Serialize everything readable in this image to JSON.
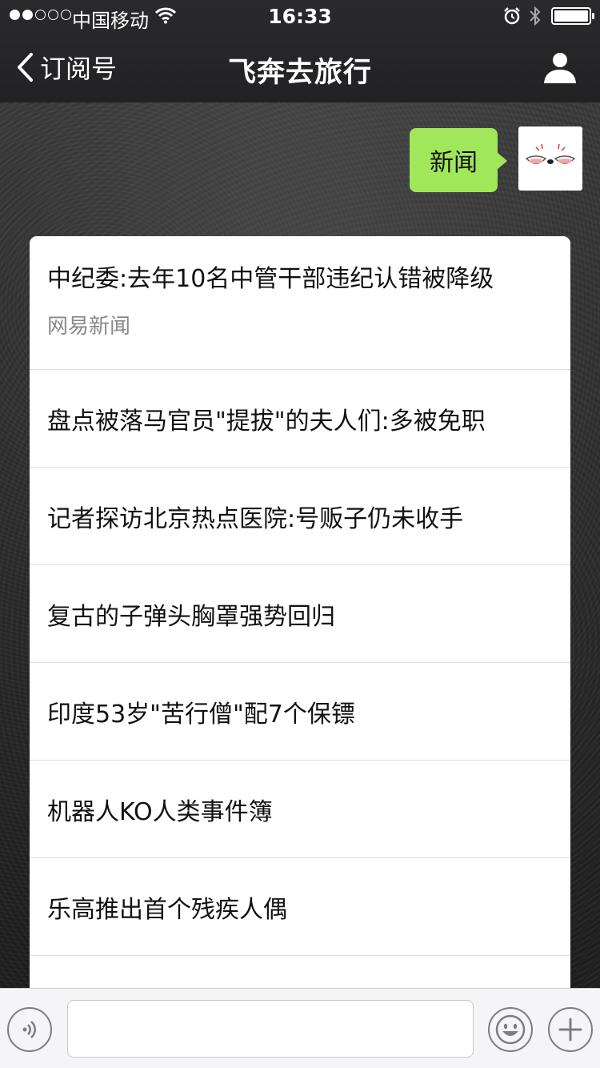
{
  "status_bar": {
    "carrier": "中国移动",
    "time": "16:33",
    "signal_bars_filled": 2,
    "signal_bars_total": 5,
    "battery_level": 1.0,
    "icons": [
      "wifi-icon",
      "alarm-icon",
      "bluetooth-icon",
      "battery-icon"
    ]
  },
  "nav": {
    "back_label": "订阅号",
    "title": "飞奔去旅行",
    "right_icon": "profile-icon"
  },
  "chat": {
    "sent_message": "新闻",
    "news_card": {
      "lead": {
        "title": "中纪委:去年10名中管干部违纪认错被降级",
        "source": "网易新闻"
      },
      "items": [
        "盘点被落马官员\"提拔\"的夫人们:多被免职",
        "记者探访北京热点医院:号贩子仍未收手",
        "复古的子弹头胸罩强势回归",
        "印度53岁\"苦行僧\"配7个保镖",
        "机器人KO人类事件簿",
        "乐高推出首个残疾人偶"
      ]
    }
  },
  "input_bar": {
    "text_value": "",
    "icons": [
      "voice-icon",
      "emoji-icon",
      "plus-icon"
    ]
  },
  "colors": {
    "nav_bg": "#262628",
    "bubble_green": "#a0e75a",
    "card_bg": "#ffffff",
    "source_gray": "#888888"
  }
}
